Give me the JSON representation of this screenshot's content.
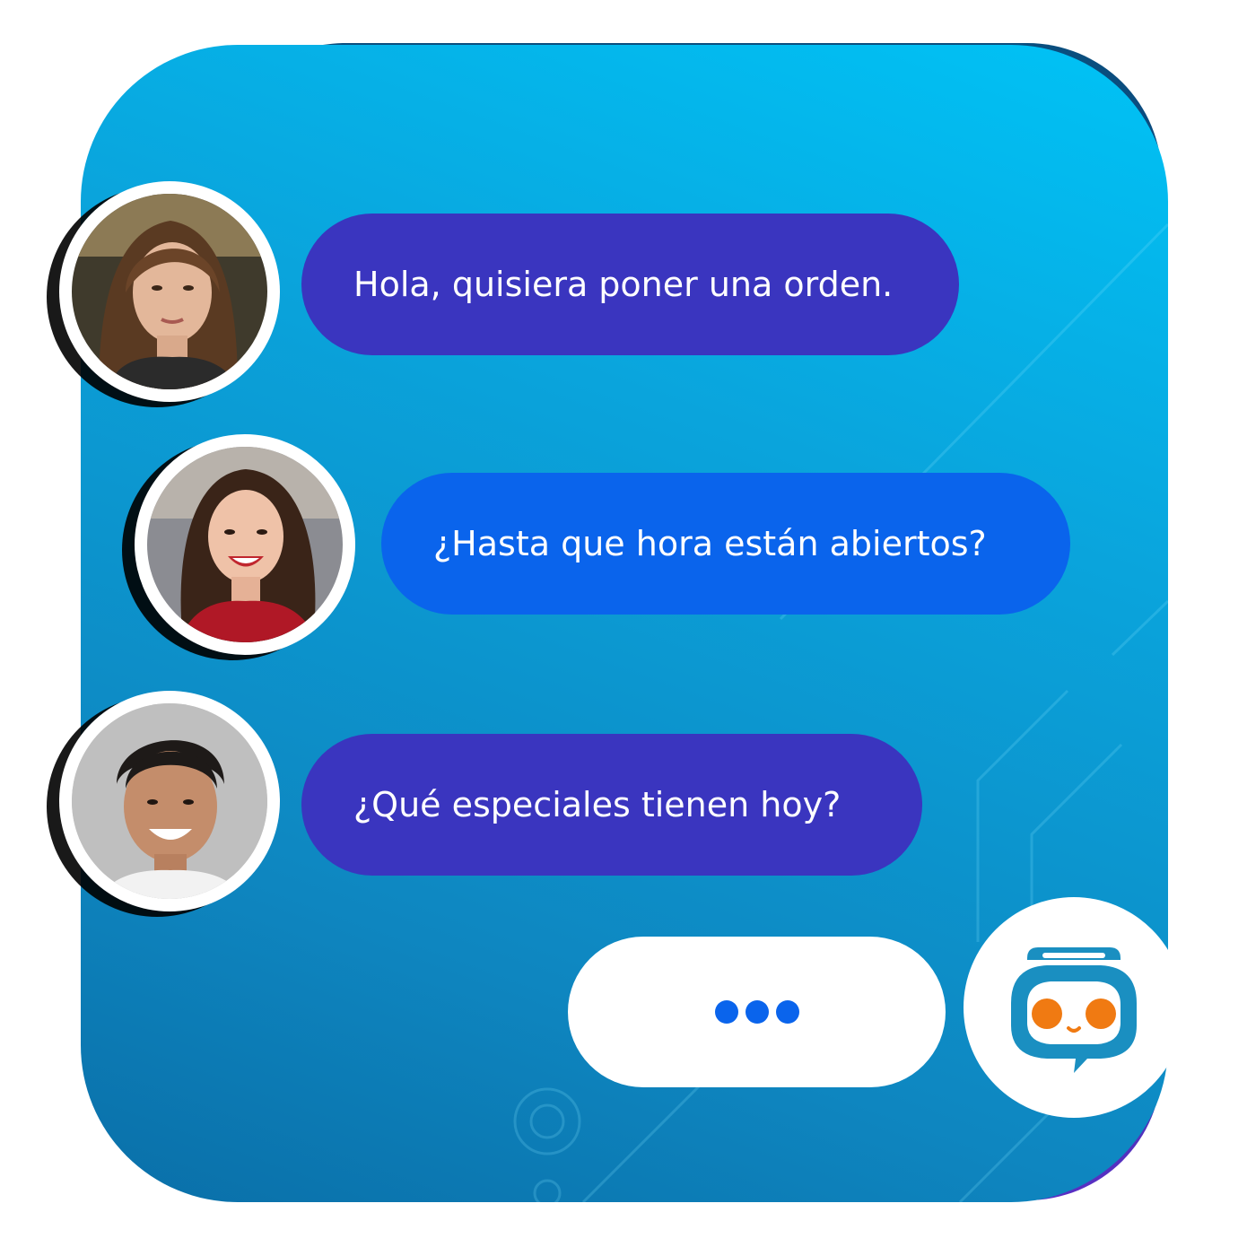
{
  "messages": [
    {
      "text": "Hola, quisiera poner una orden.",
      "avatar": "woman-long-hair",
      "style": "purple"
    },
    {
      "text": "¿Hasta que hora están abiertos?",
      "avatar": "woman-smiling-red-sweater",
      "style": "blue"
    },
    {
      "text": "¿Qué especiales tienen hoy?",
      "avatar": "man-smiling",
      "style": "purple"
    }
  ],
  "typing_indicator": {
    "dots": 3
  },
  "bot": {
    "icon": "chatbot-robot-icon"
  },
  "colors": {
    "panel": "#00b6ef",
    "bubble_purple": "#3a35bf",
    "bubble_blue": "#0a64ec",
    "typing_dot": "#0a64ec",
    "bot_body": "#1a8fc1",
    "bot_eyes": "#f07a12"
  }
}
